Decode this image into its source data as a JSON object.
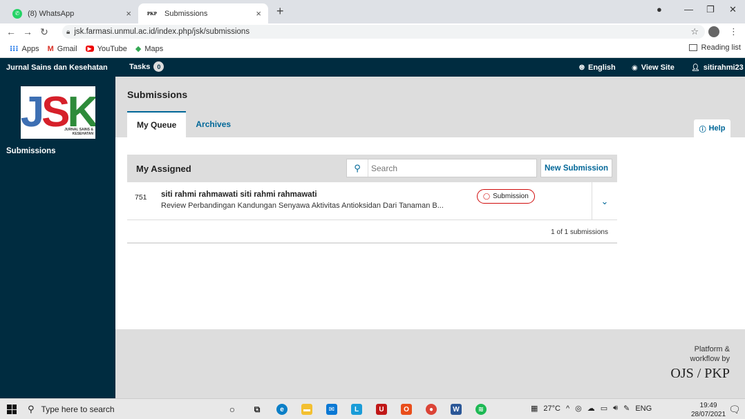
{
  "browser": {
    "tabs": [
      {
        "label": "(8) WhatsApp",
        "favicon": "whatsapp-icon",
        "active": false
      },
      {
        "label": "Submissions",
        "favicon": "pkp-icon",
        "favicon_text": "PKP",
        "active": true
      }
    ],
    "close_glyph": "×",
    "new_tab_glyph": "+",
    "url": "jsk.farmasi.unmul.ac.id/index.php/jsk/submissions",
    "bookmarks": [
      {
        "label": "Apps",
        "icon": "apps-grid-icon"
      },
      {
        "label": "Gmail",
        "icon": "gmail-icon"
      },
      {
        "label": "YouTube",
        "icon": "youtube-icon"
      },
      {
        "label": "Maps",
        "icon": "maps-icon"
      }
    ],
    "reading_list": "Reading list"
  },
  "ojs": {
    "journal_name": "Jurnal Sains dan Kesehatan",
    "tasks_label": "Tasks",
    "tasks_count": "0",
    "language": "English",
    "view_site": "View Site",
    "username": "sitirahmi23",
    "logo_text": "JSK",
    "logo_subtitle": "JURNAL SAINS & KESEHATAN"
  },
  "sidebar": {
    "items": [
      {
        "label": "Submissions"
      }
    ]
  },
  "main": {
    "page_title": "Submissions",
    "tabs": [
      {
        "label": "My Queue",
        "active": true
      },
      {
        "label": "Archives",
        "active": false
      }
    ],
    "help_label": "Help",
    "panel": {
      "title": "My Assigned",
      "search_placeholder": "Search",
      "new_submission_label": "New Submission",
      "rows": [
        {
          "id": "751",
          "author": "siti rahmi rahmawati siti rahmi rahmawati",
          "title": "Review Perbandingan Kandungan Senyawa Aktivitas Antioksidan Dari Tanaman B...",
          "stage": "Submission"
        }
      ],
      "pagination": "1 of 1 submissions"
    }
  },
  "footer": {
    "line1": "Platform &",
    "line2": "workflow by",
    "brand": "OJS / PKP"
  },
  "taskbar": {
    "search_placeholder": "Type here to search",
    "temperature": "27°C",
    "language": "ENG",
    "time": "19:49",
    "date": "28/07/2021"
  },
  "colors": {
    "ojs_navy": "#002c40",
    "link_blue": "#006798",
    "stage_red": "#d00a0a",
    "panel_gray": "#dddddd"
  }
}
